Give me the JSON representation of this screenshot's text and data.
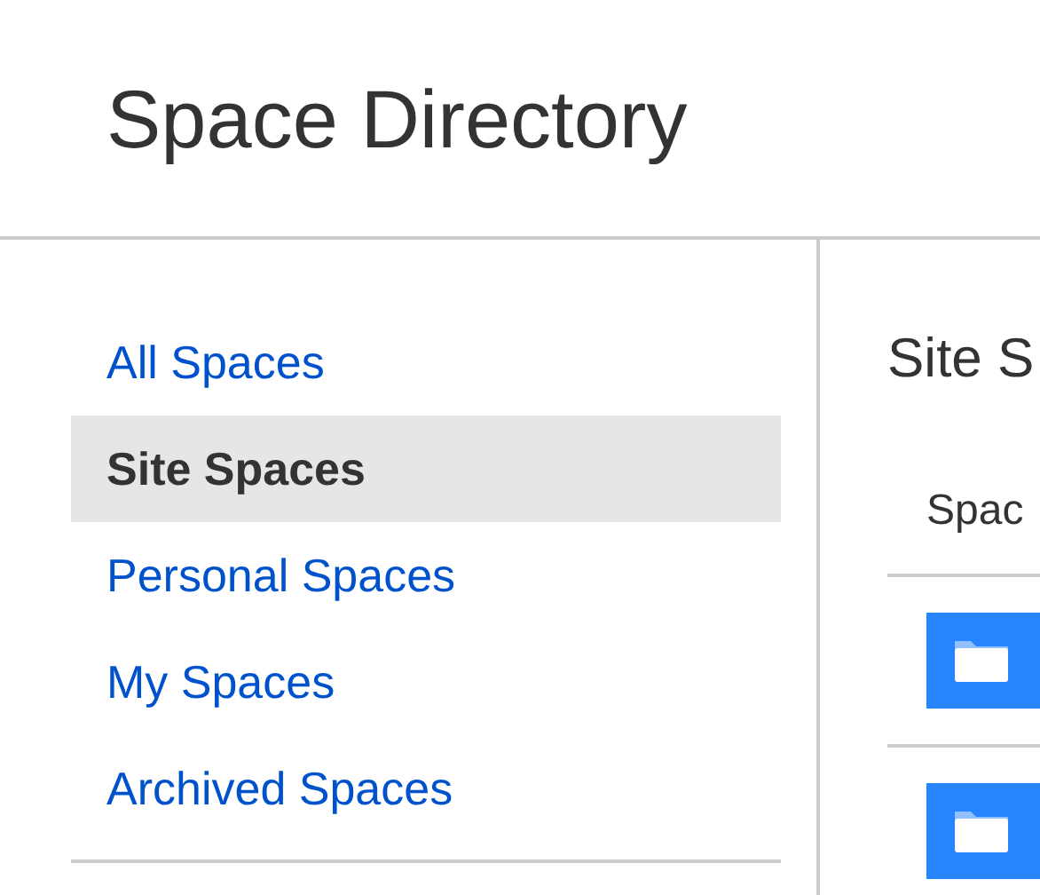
{
  "header": {
    "title": "Space Directory"
  },
  "sidebar": {
    "items": [
      {
        "label": "All Spaces",
        "selected": false
      },
      {
        "label": "Site Spaces",
        "selected": true
      },
      {
        "label": "Personal Spaces",
        "selected": false
      },
      {
        "label": "My Spaces",
        "selected": false
      },
      {
        "label": "Archived Spaces",
        "selected": false
      }
    ]
  },
  "content": {
    "title": "Site S",
    "table": {
      "columns": [
        "Spac"
      ],
      "rows": [
        {
          "kind": "space"
        },
        {
          "kind": "space"
        }
      ]
    }
  }
}
